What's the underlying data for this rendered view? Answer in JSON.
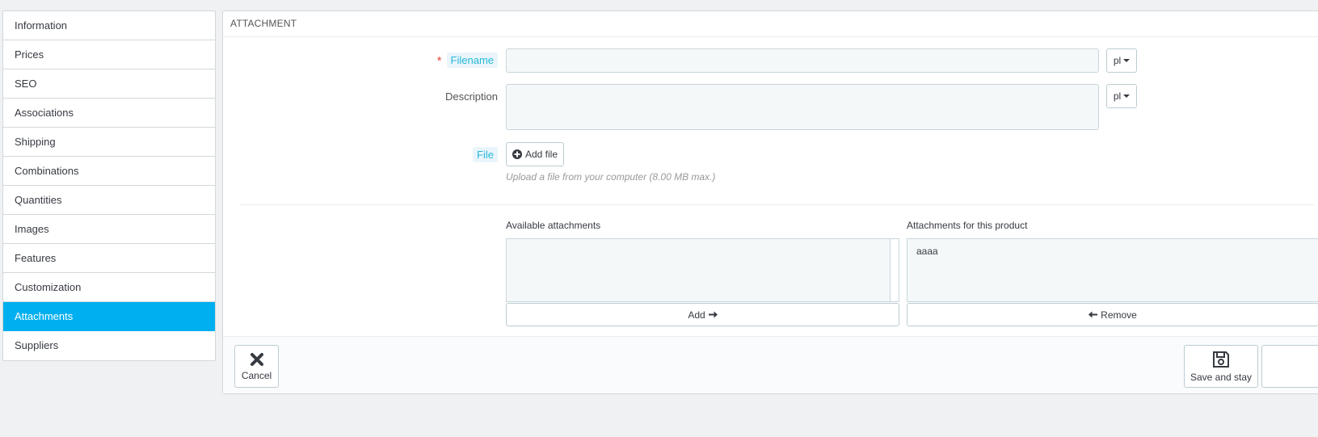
{
  "sidebar": {
    "items": [
      {
        "label": "Information"
      },
      {
        "label": "Prices"
      },
      {
        "label": "SEO"
      },
      {
        "label": "Associations"
      },
      {
        "label": "Shipping"
      },
      {
        "label": "Combinations"
      },
      {
        "label": "Quantities"
      },
      {
        "label": "Images"
      },
      {
        "label": "Features"
      },
      {
        "label": "Customization"
      },
      {
        "label": "Attachments",
        "active": true
      },
      {
        "label": "Suppliers"
      }
    ],
    "active_color": "#00aff0"
  },
  "panel": {
    "title": "Attachment",
    "filename": {
      "label": "Filename",
      "required_mark": "*",
      "value": "",
      "lang": "pl"
    },
    "description": {
      "label": "Description",
      "value": "",
      "lang": "pl"
    },
    "file": {
      "label": "File",
      "add_button": "Add file",
      "help": "Upload a file from your computer (8.00 MB max.)"
    },
    "available": {
      "label": "Available attachments",
      "items": [],
      "add_button": "Add"
    },
    "product": {
      "label": "Attachments for this product",
      "items": [
        "aaaa"
      ],
      "remove_button": "Remove"
    }
  },
  "footer": {
    "cancel_label": "Cancel",
    "save_stay_label": "Save and stay"
  },
  "icons": {
    "plus_circle": "plus-circle-icon",
    "arrow_right": "arrow-right-icon",
    "arrow_left": "arrow-left-icon",
    "close": "close-icon",
    "save": "floppy-disk-icon"
  }
}
